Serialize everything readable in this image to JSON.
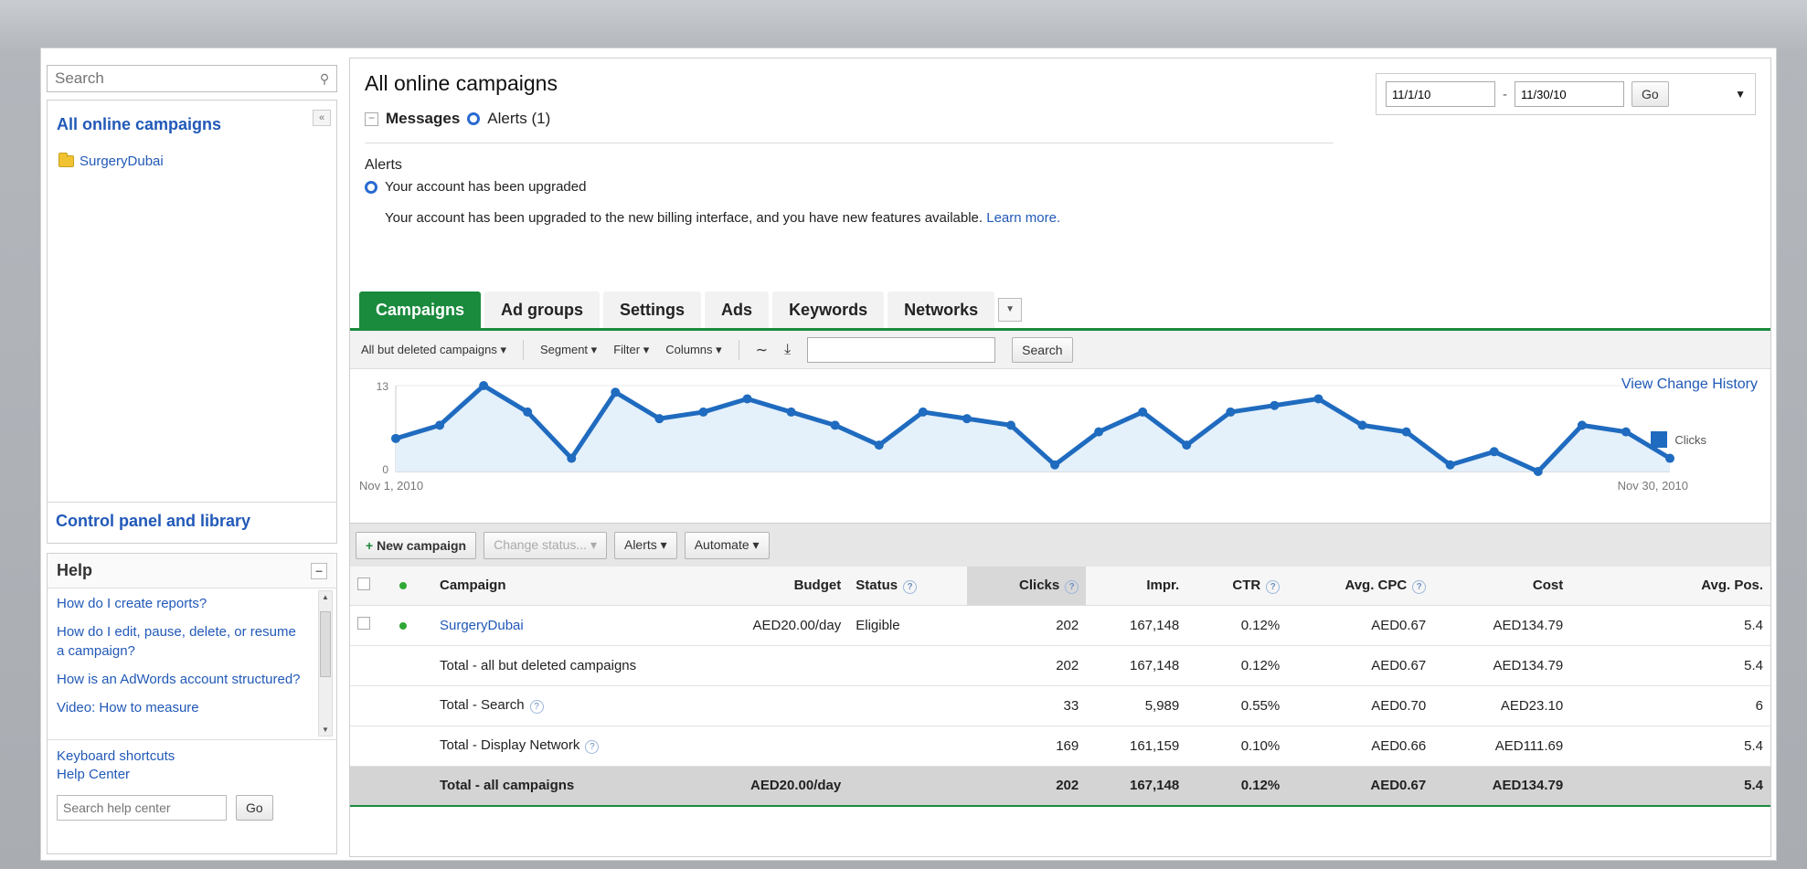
{
  "sidebar": {
    "search_placeholder": "Search",
    "tree_title": "All online campaigns",
    "tree_items": [
      {
        "label": "SurgeryDubai"
      }
    ],
    "control_panel": "Control panel and library",
    "help": {
      "title": "Help",
      "links": [
        "How do I create reports?",
        "How do I edit, pause, delete, or resume a campaign?",
        "How is an AdWords account structured?",
        "Video: How to measure"
      ],
      "keyboard_shortcuts": "Keyboard shortcuts",
      "help_center": "Help Center",
      "search_placeholder": "Search help center",
      "go_label": "Go"
    }
  },
  "header": {
    "title": "All online campaigns",
    "messages_label": "Messages",
    "alerts_label": "Alerts (1)",
    "date_from": "11/1/10",
    "date_to": "11/30/10",
    "go_label": "Go"
  },
  "alert": {
    "section_title": "Alerts",
    "headline": "Your account has been upgraded",
    "description": "Your account has been upgraded to the new billing interface, and you have new features available.",
    "learn_more": "Learn more."
  },
  "tabs": [
    "Campaigns",
    "Ad groups",
    "Settings",
    "Ads",
    "Keywords",
    "Networks"
  ],
  "toolbar": {
    "filter_view": "All but deleted campaigns",
    "segment": "Segment",
    "filter": "Filter",
    "columns": "Columns",
    "search_label": "Search"
  },
  "view_change_history": "View Change History",
  "chart_data": {
    "type": "line",
    "x_start_label": "Nov 1, 2010",
    "x_end_label": "Nov 30, 2010",
    "y_ticks": [
      "13",
      "0"
    ],
    "ylim": [
      0,
      13
    ],
    "series": [
      {
        "name": "Clicks",
        "color": "#1f6bbf",
        "values": [
          5,
          7,
          13,
          9,
          2,
          12,
          8,
          9,
          11,
          9,
          7,
          4,
          9,
          8,
          7,
          1,
          6,
          9,
          4,
          9,
          10,
          11,
          7,
          6,
          1,
          3,
          0,
          7,
          6,
          2
        ]
      }
    ]
  },
  "actions": {
    "new_campaign": "New campaign",
    "change_status": "Change status...",
    "alerts": "Alerts",
    "automate": "Automate"
  },
  "table": {
    "columns": [
      "Campaign",
      "Budget",
      "Status",
      "Clicks",
      "Impr.",
      "CTR",
      "Avg. CPC",
      "Cost",
      "Avg. Pos."
    ],
    "rows": [
      {
        "campaign": "SurgeryDubai",
        "budget": "AED20.00/day",
        "status": "Eligible",
        "clicks": "202",
        "impr": "167,148",
        "ctr": "0.12%",
        "cpc": "AED0.67",
        "cost": "AED134.79",
        "pos": "5.4"
      }
    ],
    "totals": [
      {
        "label": "Total - all but deleted campaigns",
        "budget": "",
        "clicks": "202",
        "impr": "167,148",
        "ctr": "0.12%",
        "cpc": "AED0.67",
        "cost": "AED134.79",
        "pos": "5.4"
      },
      {
        "label": "Total - Search",
        "budget": "",
        "clicks": "33",
        "impr": "5,989",
        "ctr": "0.55%",
        "cpc": "AED0.70",
        "cost": "AED23.10",
        "pos": "6"
      },
      {
        "label": "Total - Display Network",
        "budget": "",
        "clicks": "169",
        "impr": "161,159",
        "ctr": "0.10%",
        "cpc": "AED0.66",
        "cost": "AED111.69",
        "pos": "5.4"
      }
    ],
    "grand_total": {
      "label": "Total - all campaigns",
      "budget": "AED20.00/day",
      "clicks": "202",
      "impr": "167,148",
      "ctr": "0.12%",
      "cpc": "AED0.67",
      "cost": "AED134.79",
      "pos": "5.4"
    }
  }
}
